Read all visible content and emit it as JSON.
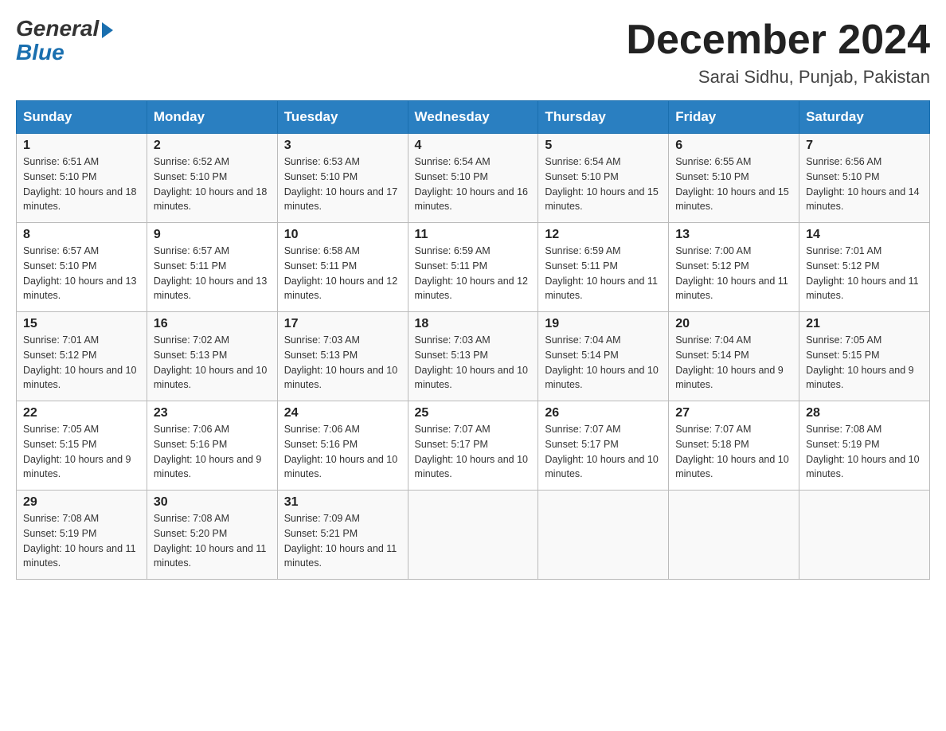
{
  "logo": {
    "general": "General",
    "blue": "Blue"
  },
  "title": "December 2024",
  "location": "Sarai Sidhu, Punjab, Pakistan",
  "days_of_week": [
    "Sunday",
    "Monday",
    "Tuesday",
    "Wednesday",
    "Thursday",
    "Friday",
    "Saturday"
  ],
  "weeks": [
    [
      {
        "day": 1,
        "sunrise": "6:51 AM",
        "sunset": "5:10 PM",
        "daylight": "10 hours and 18 minutes."
      },
      {
        "day": 2,
        "sunrise": "6:52 AM",
        "sunset": "5:10 PM",
        "daylight": "10 hours and 18 minutes."
      },
      {
        "day": 3,
        "sunrise": "6:53 AM",
        "sunset": "5:10 PM",
        "daylight": "10 hours and 17 minutes."
      },
      {
        "day": 4,
        "sunrise": "6:54 AM",
        "sunset": "5:10 PM",
        "daylight": "10 hours and 16 minutes."
      },
      {
        "day": 5,
        "sunrise": "6:54 AM",
        "sunset": "5:10 PM",
        "daylight": "10 hours and 15 minutes."
      },
      {
        "day": 6,
        "sunrise": "6:55 AM",
        "sunset": "5:10 PM",
        "daylight": "10 hours and 15 minutes."
      },
      {
        "day": 7,
        "sunrise": "6:56 AM",
        "sunset": "5:10 PM",
        "daylight": "10 hours and 14 minutes."
      }
    ],
    [
      {
        "day": 8,
        "sunrise": "6:57 AM",
        "sunset": "5:10 PM",
        "daylight": "10 hours and 13 minutes."
      },
      {
        "day": 9,
        "sunrise": "6:57 AM",
        "sunset": "5:11 PM",
        "daylight": "10 hours and 13 minutes."
      },
      {
        "day": 10,
        "sunrise": "6:58 AM",
        "sunset": "5:11 PM",
        "daylight": "10 hours and 12 minutes."
      },
      {
        "day": 11,
        "sunrise": "6:59 AM",
        "sunset": "5:11 PM",
        "daylight": "10 hours and 12 minutes."
      },
      {
        "day": 12,
        "sunrise": "6:59 AM",
        "sunset": "5:11 PM",
        "daylight": "10 hours and 11 minutes."
      },
      {
        "day": 13,
        "sunrise": "7:00 AM",
        "sunset": "5:12 PM",
        "daylight": "10 hours and 11 minutes."
      },
      {
        "day": 14,
        "sunrise": "7:01 AM",
        "sunset": "5:12 PM",
        "daylight": "10 hours and 11 minutes."
      }
    ],
    [
      {
        "day": 15,
        "sunrise": "7:01 AM",
        "sunset": "5:12 PM",
        "daylight": "10 hours and 10 minutes."
      },
      {
        "day": 16,
        "sunrise": "7:02 AM",
        "sunset": "5:13 PM",
        "daylight": "10 hours and 10 minutes."
      },
      {
        "day": 17,
        "sunrise": "7:03 AM",
        "sunset": "5:13 PM",
        "daylight": "10 hours and 10 minutes."
      },
      {
        "day": 18,
        "sunrise": "7:03 AM",
        "sunset": "5:13 PM",
        "daylight": "10 hours and 10 minutes."
      },
      {
        "day": 19,
        "sunrise": "7:04 AM",
        "sunset": "5:14 PM",
        "daylight": "10 hours and 10 minutes."
      },
      {
        "day": 20,
        "sunrise": "7:04 AM",
        "sunset": "5:14 PM",
        "daylight": "10 hours and 9 minutes."
      },
      {
        "day": 21,
        "sunrise": "7:05 AM",
        "sunset": "5:15 PM",
        "daylight": "10 hours and 9 minutes."
      }
    ],
    [
      {
        "day": 22,
        "sunrise": "7:05 AM",
        "sunset": "5:15 PM",
        "daylight": "10 hours and 9 minutes."
      },
      {
        "day": 23,
        "sunrise": "7:06 AM",
        "sunset": "5:16 PM",
        "daylight": "10 hours and 9 minutes."
      },
      {
        "day": 24,
        "sunrise": "7:06 AM",
        "sunset": "5:16 PM",
        "daylight": "10 hours and 10 minutes."
      },
      {
        "day": 25,
        "sunrise": "7:07 AM",
        "sunset": "5:17 PM",
        "daylight": "10 hours and 10 minutes."
      },
      {
        "day": 26,
        "sunrise": "7:07 AM",
        "sunset": "5:17 PM",
        "daylight": "10 hours and 10 minutes."
      },
      {
        "day": 27,
        "sunrise": "7:07 AM",
        "sunset": "5:18 PM",
        "daylight": "10 hours and 10 minutes."
      },
      {
        "day": 28,
        "sunrise": "7:08 AM",
        "sunset": "5:19 PM",
        "daylight": "10 hours and 10 minutes."
      }
    ],
    [
      {
        "day": 29,
        "sunrise": "7:08 AM",
        "sunset": "5:19 PM",
        "daylight": "10 hours and 11 minutes."
      },
      {
        "day": 30,
        "sunrise": "7:08 AM",
        "sunset": "5:20 PM",
        "daylight": "10 hours and 11 minutes."
      },
      {
        "day": 31,
        "sunrise": "7:09 AM",
        "sunset": "5:21 PM",
        "daylight": "10 hours and 11 minutes."
      },
      null,
      null,
      null,
      null
    ]
  ]
}
